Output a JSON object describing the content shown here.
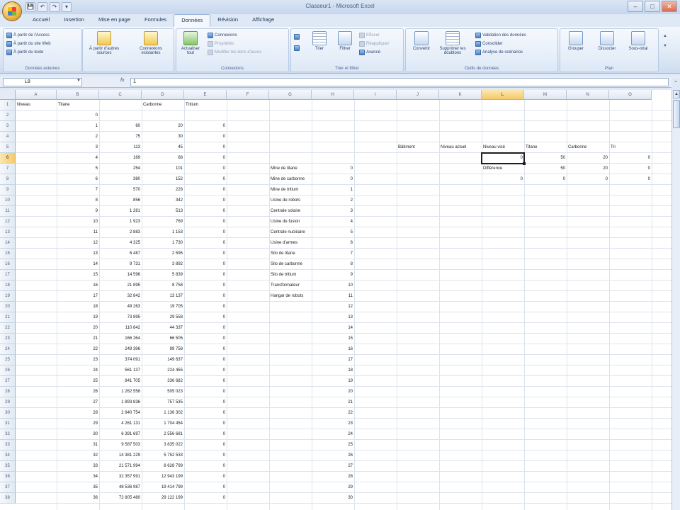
{
  "window": {
    "title": "Classeur1 - Microsoft Excel"
  },
  "qat": [
    "💾",
    "↶",
    "↷",
    "▾"
  ],
  "tabs": [
    "Accueil",
    "Insertion",
    "Mise en page",
    "Formules",
    "Données",
    "Révision",
    "Affichage"
  ],
  "active_tab": 4,
  "ribbon": {
    "groups": [
      {
        "label": "Données externes",
        "commands": [
          {
            "label": "À partir de l'Access",
            "icon": "access-icon"
          },
          {
            "label": "À partir du site Web",
            "icon": "web-icon"
          },
          {
            "label": "À partir du texte",
            "icon": "text-file-icon"
          },
          {
            "label": "À partir d'autres sources",
            "icon": "other-sources-icon"
          },
          {
            "label": "Connexions existantes",
            "icon": "connections-icon"
          }
        ]
      },
      {
        "label": "Connexions",
        "commands": [
          {
            "label": "Actualiser tout",
            "icon": "refresh-icon"
          },
          {
            "label": "Connexions",
            "icon": "connections-icon"
          },
          {
            "label": "Propriétés",
            "icon": "properties-icon"
          },
          {
            "label": "Modifier les liens d'accès",
            "icon": "links-icon"
          }
        ]
      },
      {
        "label": "Trier et filtrer",
        "commands": [
          {
            "label": "Trier",
            "icon": "sort-icon"
          },
          {
            "label": "Filtrer",
            "icon": "filter-icon"
          },
          {
            "label": "Effacer",
            "icon": "clear-icon"
          },
          {
            "label": "Réappliquer",
            "icon": "reapply-icon"
          },
          {
            "label": "Avancé",
            "icon": "advanced-icon"
          }
        ]
      },
      {
        "label": "Outils de données",
        "commands": [
          {
            "label": "Convertir",
            "icon": "convert-icon"
          },
          {
            "label": "Supprimer les doublons",
            "icon": "duplicates-icon"
          },
          {
            "label": "Validation des données",
            "icon": "validation-icon"
          },
          {
            "label": "Consolider",
            "icon": "consolidate-icon"
          },
          {
            "label": "Analyse de scénarios",
            "icon": "whatif-icon"
          }
        ]
      },
      {
        "label": "Plan",
        "commands": [
          {
            "label": "Grouper",
            "icon": "group-icon"
          },
          {
            "label": "Dissocier",
            "icon": "ungroup-icon"
          },
          {
            "label": "Sous-total",
            "icon": "subtotal-icon"
          }
        ]
      }
    ]
  },
  "formula_bar": {
    "name_box": "L8",
    "fx": "fx",
    "value": "1"
  },
  "grid": {
    "columns": [
      "A",
      "B",
      "C",
      "D",
      "E",
      "F",
      "G",
      "H",
      "I",
      "J",
      "K",
      "L",
      "M",
      "N",
      "O"
    ],
    "selected_column": "L",
    "selected_row": 6,
    "row_count": 38,
    "column_A": [
      "Niveau",
      "",
      "",
      "",
      "",
      "",
      "",
      "",
      "",
      "",
      "",
      "",
      "",
      "",
      "",
      "",
      "",
      "",
      "",
      "",
      "",
      "",
      "",
      "",
      "",
      "",
      "",
      "",
      "",
      "",
      "",
      "",
      "",
      "",
      "",
      "",
      "",
      ""
    ],
    "column_B": [
      "Titane",
      "0",
      "1",
      "2",
      "3",
      "4",
      "5",
      "6",
      "7",
      "8",
      "9",
      "10",
      "11",
      "12",
      "13",
      "14",
      "15",
      "16",
      "17",
      "18",
      "19",
      "20",
      "21",
      "22",
      "23",
      "24",
      "25",
      "26",
      "27",
      "28",
      "29",
      "30",
      "31",
      "32",
      "33",
      "34",
      "35",
      "36"
    ],
    "column_C": [
      "",
      "",
      "60",
      "75",
      "113",
      "169",
      "254",
      "380",
      "570",
      "856",
      "1 281",
      "1 923",
      "2 883",
      "4 325",
      "6 487",
      "9 731",
      "14 596",
      "21 895",
      "32 842",
      "49 263",
      "73 895",
      "110 842",
      "166 264",
      "249 396",
      "374 091",
      "561 137",
      "841 705",
      "1 262 558",
      "1 893 836",
      "2 840 754",
      "4 261 131",
      "6 391 697",
      "9 587 503",
      "14 381 229",
      "21 571 994",
      "32 357 991",
      "48 536 987",
      "72 805 480"
    ],
    "column_D": [
      "Carbonne",
      "",
      "20",
      "30",
      "45",
      "68",
      "101",
      "152",
      "228",
      "342",
      "513",
      "769",
      "1 153",
      "1 730",
      "2 595",
      "3 892",
      "5 839",
      "8 758",
      "13 137",
      "19 705",
      "29 558",
      "44 337",
      "66 505",
      "99 758",
      "149 637",
      "224 455",
      "336 682",
      "505 023",
      "757 535",
      "1 136 302",
      "1 704 454",
      "2 556 681",
      "3 835 022",
      "5 752 533",
      "8 628 799",
      "12 943 199",
      "19 414 799",
      "29 122 199"
    ],
    "column_E": [
      "Tritium",
      "",
      "0",
      "0",
      "0",
      "0",
      "0",
      "0",
      "0",
      "0",
      "0",
      "0",
      "0",
      "0",
      "0",
      "0",
      "0",
      "0",
      "0",
      "0",
      "0",
      "0",
      "0",
      "0",
      "0",
      "0",
      "0",
      "0",
      "0",
      "0",
      "0",
      "0",
      "0",
      "0",
      "0",
      "0",
      "0",
      "0"
    ],
    "column_G": [
      "",
      "",
      "",
      "",
      "",
      "",
      "Mine de titane",
      "Mine de carbonne",
      "Mine de tritium",
      "Usine de robots",
      "Centrale solaire",
      "Usine de fusion",
      "Centrale nucléaire",
      "Usine d'armes",
      "Silo de titane",
      "Silo de carbonne",
      "Silo de tritium",
      "Transformateur",
      "Hangar de robots"
    ],
    "column_H": [
      "",
      "",
      "",
      "",
      "",
      "",
      "0",
      "0",
      "1",
      "2",
      "3",
      "4",
      "5",
      "6",
      "7",
      "8",
      "9",
      "10",
      "11",
      "12",
      "13",
      "14",
      "15",
      "16",
      "17",
      "18",
      "19",
      "20",
      "21",
      "22",
      "23",
      "24",
      "25",
      "26",
      "27",
      "28",
      "29",
      "30"
    ],
    "block_J_O": {
      "row5_labels": [
        {
          "col": "J",
          "text": "Bâtiment"
        },
        {
          "col": "K",
          "text": "Niveau actuel"
        },
        {
          "col": "L",
          "text": "Niveau visé"
        },
        {
          "col": "M",
          "text": "Titane"
        },
        {
          "col": "N",
          "text": "Carbonne"
        },
        {
          "col": "O",
          "text": "Tri"
        }
      ],
      "row6_values": [
        {
          "col": "L",
          "text": "0"
        },
        {
          "col": "M",
          "text": "50"
        },
        {
          "col": "N",
          "text": "20"
        },
        {
          "col": "O",
          "text": "0"
        }
      ],
      "row7_values": [
        {
          "col": "L",
          "text": "Différence"
        },
        {
          "col": "M",
          "text": "50"
        },
        {
          "col": "N",
          "text": "20"
        },
        {
          "col": "O",
          "text": "0"
        }
      ],
      "row8_values": [
        {
          "col": "L",
          "text": "0"
        },
        {
          "col": "M",
          "text": "0"
        },
        {
          "col": "N",
          "text": "0"
        },
        {
          "col": "O",
          "text": "0"
        }
      ]
    }
  }
}
